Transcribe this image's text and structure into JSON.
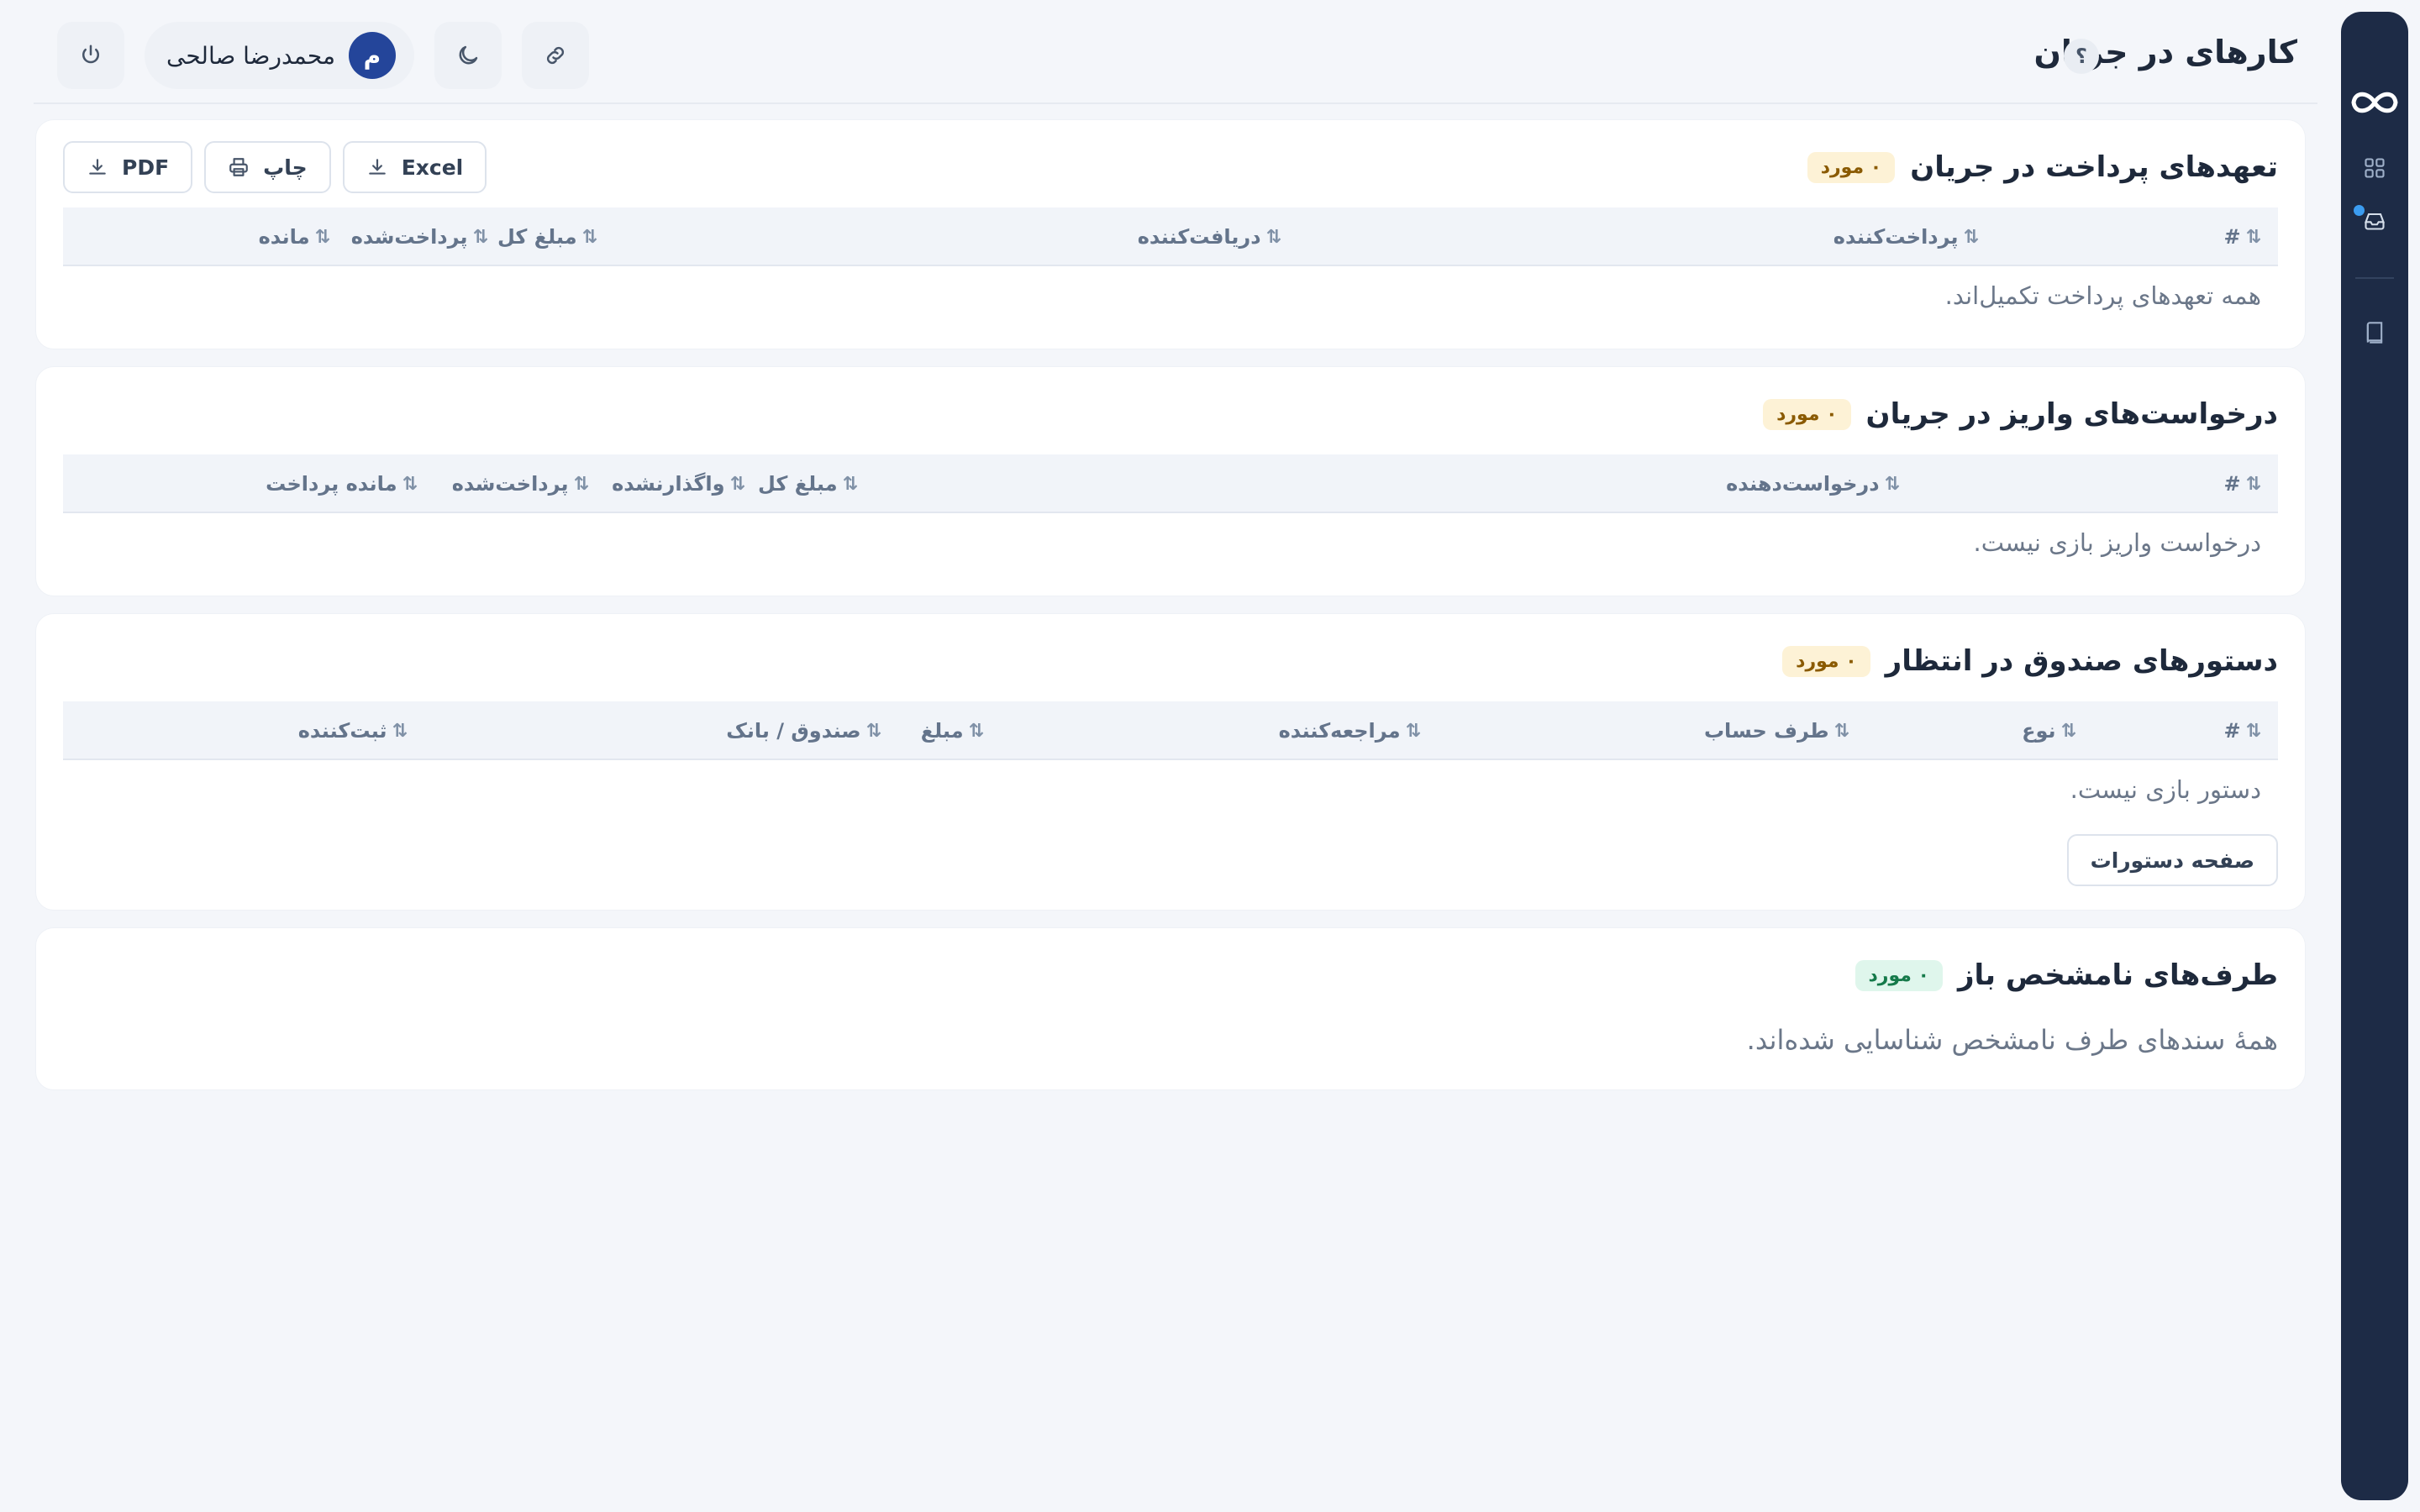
{
  "header": {
    "title": "کارهای در جریان",
    "help_label": "؟",
    "user_name": "محمدرضا صالحی",
    "user_initial": "م"
  },
  "rail": {
    "items": [
      "logo-icon",
      "dashboard-icon",
      "inbox-icon",
      "book-icon"
    ]
  },
  "exports": {
    "excel": "Excel",
    "print": "چاپ",
    "pdf": "PDF"
  },
  "sort_glyph": "⇅",
  "sections": {
    "commitments": {
      "title": "تعهدهای پرداخت در جریان",
      "badge": "۰ مورد",
      "columns": [
        "#",
        "پرداخت‌کننده",
        "دریافت‌کننده",
        "مبلغ کل",
        "پرداخت‌شده",
        "مانده"
      ],
      "empty": "همه تعهدهای پرداخت تکمیل‌اند."
    },
    "deposits": {
      "title": "درخواست‌های واریز در جریان",
      "badge": "۰ مورد",
      "columns": [
        "#",
        "درخواست‌دهنده",
        "مبلغ کل",
        "واگذارنشده",
        "پرداخت‌شده",
        "مانده پرداخت"
      ],
      "empty": "درخواست واریز بازی نیست."
    },
    "cash_orders": {
      "title": "دستورهای صندوق در انتظار",
      "badge": "۰ مورد",
      "columns": [
        "#",
        "نوع",
        "طرف حساب",
        "مراجعه‌کننده",
        "مبلغ",
        "صندوق / بانک",
        "ثبت‌کننده"
      ],
      "empty": "دستور بازی نیست.",
      "footer_button": "صفحه دستورات"
    },
    "unknown_parties": {
      "title": "طرف‌های نامشخص باز",
      "badge": "۰ مورد",
      "message": "همهٔ سندهای طرف نامشخص شناسایی شده‌اند."
    }
  },
  "colors": {
    "rail_bg": "#1d2b46",
    "avatar_bg": "#24459a",
    "badge_amber_bg": "#fdf2d6",
    "badge_green_bg": "#dff6ec",
    "notification_dot": "#3b9cf0"
  }
}
